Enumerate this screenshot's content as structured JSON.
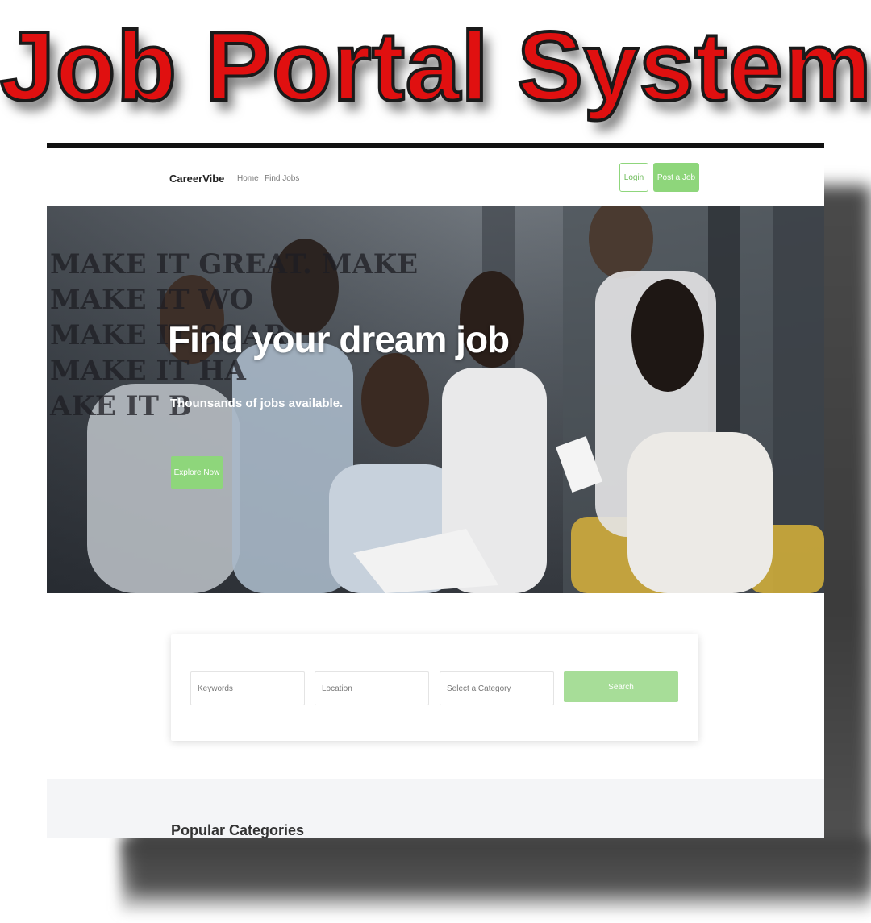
{
  "banner": {
    "title": "Job Portal System"
  },
  "nav": {
    "brand": "CareerVibe",
    "links": [
      "Home",
      "Find Jobs"
    ],
    "login_label": "Login",
    "post_job_label": "Post a Job"
  },
  "hero": {
    "wall_text": [
      "MAKE IT GREAT. MAKE",
      "MAKE IT WO",
      "MAKE IT SOAR",
      "MAKE IT HA",
      "AKE IT B"
    ],
    "title": "Find your dream job",
    "subtitle": "Thounsands of jobs available.",
    "explore_label": "Explore Now"
  },
  "search": {
    "keywords_placeholder": "Keywords",
    "location_placeholder": "Location",
    "category_placeholder": "Select a Category",
    "search_label": "Search"
  },
  "categories": {
    "title": "Popular Categories"
  },
  "colors": {
    "accent": "#8ed67b",
    "banner_red": "#e01010"
  }
}
